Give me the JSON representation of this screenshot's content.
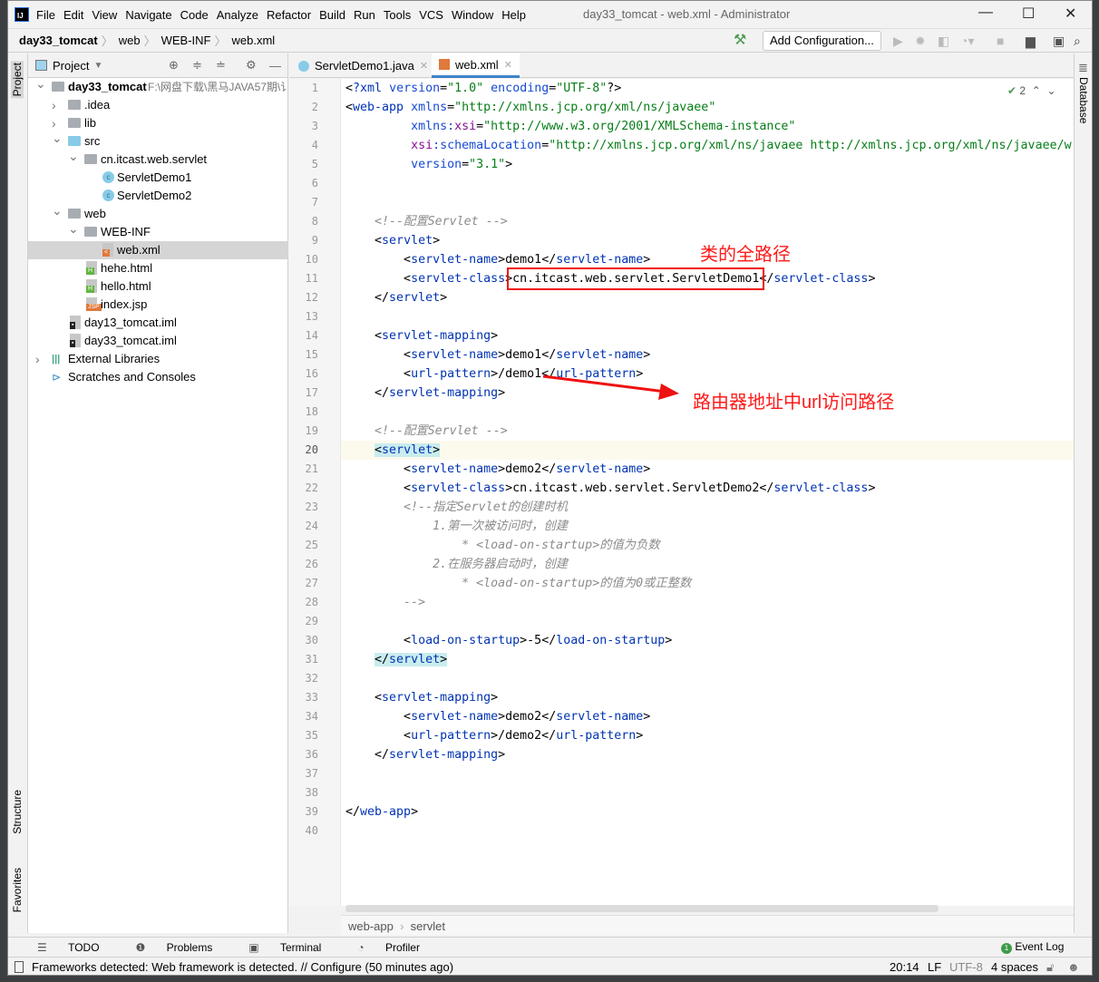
{
  "app": {
    "title": "day33_tomcat - web.xml - Administrator",
    "logo": "IJ"
  },
  "menu": [
    "File",
    "Edit",
    "View",
    "Navigate",
    "Code",
    "Analyze",
    "Refactor",
    "Build",
    "Run",
    "Tools",
    "VCS",
    "Window",
    "Help"
  ],
  "breadcrumb": [
    "day33_tomcat",
    "web",
    "WEB-INF",
    "web.xml"
  ],
  "toolbar": {
    "add_config": "Add Configuration..."
  },
  "side_tabs": {
    "project": "Project",
    "structure": "Structure",
    "favorites": "Favorites",
    "database": "Database"
  },
  "project_panel": {
    "title": "Project",
    "tree": [
      {
        "label": "day33_tomcat",
        "extra": "F:\\网盘下载\\黑马JAVA57期\\讠",
        "depth": 0,
        "arrow": "open",
        "icon": "module",
        "bold": true
      },
      {
        "label": ".idea",
        "depth": 1,
        "arrow": "closed",
        "icon": "folder"
      },
      {
        "label": "lib",
        "depth": 1,
        "arrow": "closed",
        "icon": "folder"
      },
      {
        "label": "src",
        "depth": 1,
        "arrow": "open",
        "icon": "src-folder"
      },
      {
        "label": "cn.itcast.web.servlet",
        "depth": 2,
        "arrow": "open",
        "icon": "package"
      },
      {
        "label": "ServletDemo1",
        "depth": 3,
        "icon": "class"
      },
      {
        "label": "ServletDemo2",
        "depth": 3,
        "icon": "class"
      },
      {
        "label": "web",
        "depth": 1,
        "arrow": "open",
        "icon": "folder"
      },
      {
        "label": "WEB-INF",
        "depth": 2,
        "arrow": "open",
        "icon": "folder"
      },
      {
        "label": "web.xml",
        "depth": 3,
        "icon": "xml",
        "selected": true
      },
      {
        "label": "hehe.html",
        "depth": 2,
        "icon": "html"
      },
      {
        "label": "hello.html",
        "depth": 2,
        "icon": "html"
      },
      {
        "label": "index.jsp",
        "depth": 2,
        "icon": "jsp"
      },
      {
        "label": "day13_tomcat.iml",
        "depth": 1,
        "icon": "iml"
      },
      {
        "label": "day33_tomcat.iml",
        "depth": 1,
        "icon": "iml"
      },
      {
        "label": "External Libraries",
        "depth": 0,
        "arrow": "closed",
        "icon": "libraries"
      },
      {
        "label": "Scratches and Consoles",
        "depth": 0,
        "icon": "scratches"
      }
    ]
  },
  "tabs": [
    {
      "label": "ServletDemo1.java",
      "icon": "class",
      "active": false
    },
    {
      "label": "web.xml",
      "icon": "xml",
      "active": true
    }
  ],
  "editor": {
    "inspection_count": "2",
    "current_line": 20,
    "lines": [
      "<?xml version=\"1.0\" encoding=\"UTF-8\"?>",
      "<web-app xmlns=\"http://xmlns.jcp.org/xml/ns/javaee\"",
      "         xmlns:xsi=\"http://www.w3.org/2001/XMLSchema-instance\"",
      "         xsi:schemaLocation=\"http://xmlns.jcp.org/xml/ns/javaee http://xmlns.jcp.org/xml/ns/javaee/w",
      "         version=\"3.1\">",
      "",
      "",
      "    <!--配置Servlet -->",
      "    <servlet>",
      "        <servlet-name>demo1</servlet-name>",
      "        <servlet-class>cn.itcast.web.servlet.ServletDemo1</servlet-class>",
      "    </servlet>",
      "",
      "    <servlet-mapping>",
      "        <servlet-name>demo1</servlet-name>",
      "        <url-pattern>/demo1</url-pattern>",
      "    </servlet-mapping>",
      "",
      "    <!--配置Servlet -->",
      "    <servlet>",
      "        <servlet-name>demo2</servlet-name>",
      "        <servlet-class>cn.itcast.web.servlet.ServletDemo2</servlet-class>",
      "        <!--指定Servlet的创建时机",
      "            1.第一次被访问时，创建",
      "                * <load-on-startup>的值为负数",
      "            2.在服务器启动时，创建",
      "                * <load-on-startup>的值为0或正整数",
      "        -->",
      "",
      "        <load-on-startup>-5</load-on-startup>",
      "    </servlet>",
      "",
      "    <servlet-mapping>",
      "        <servlet-name>demo2</servlet-name>",
      "        <url-pattern>/demo2</url-pattern>",
      "    </servlet-mapping>",
      "",
      "",
      "</web-app>",
      ""
    ],
    "breadcrumb": [
      "web-app",
      "servlet"
    ]
  },
  "annotations": {
    "class_path": "类的全路径",
    "url_path": "路由器地址中url访问路径",
    "color": "#ff1a1a"
  },
  "bottom_tools": [
    "TODO",
    "Problems",
    "Terminal",
    "Profiler"
  ],
  "event_log": "Event Log",
  "status": {
    "message": "Frameworks detected: Web framework is detected. // Configure (50 minutes ago)",
    "position": "20:14",
    "line_sep": "LF",
    "encoding": "UTF-8",
    "indent": "4 spaces"
  }
}
